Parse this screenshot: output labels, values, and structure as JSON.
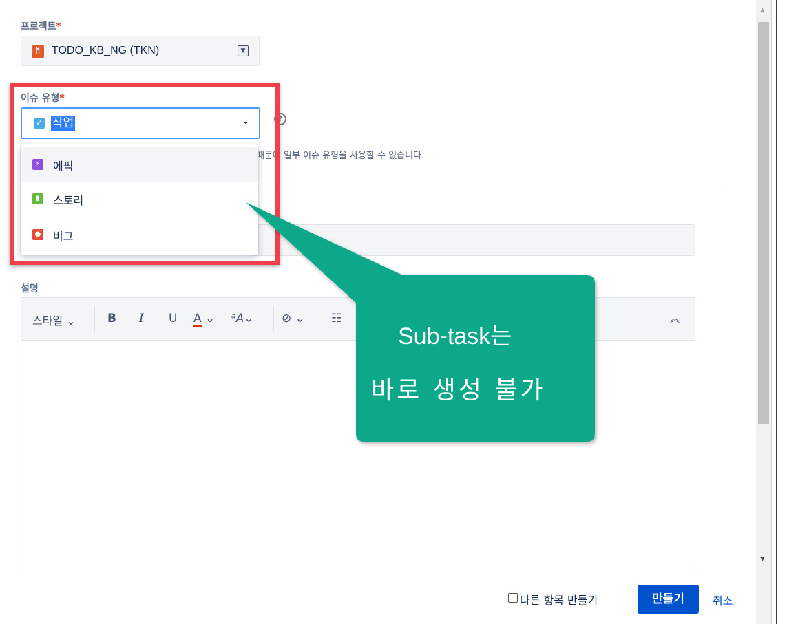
{
  "project": {
    "label": "프로젝트",
    "required_mark": "*",
    "value": "TODO_KB_NG (TKN)",
    "icon": "project-avatar-icon"
  },
  "issue_type": {
    "label": "이슈 유형",
    "required_mark": "*",
    "value": "작업",
    "icon": "task-check-icon",
    "help_icon": "?",
    "note": "때문에 일부 이슈 유형을 사용할 수 없습니다.",
    "options": [
      {
        "label": "에픽",
        "icon": "epic-lightning-icon",
        "color": "#904ee2"
      },
      {
        "label": "스토리",
        "icon": "story-bookmark-icon",
        "color": "#63ba3c"
      },
      {
        "label": "버그",
        "icon": "bug-dot-icon",
        "color": "#e5493a"
      }
    ]
  },
  "description": {
    "label": "설명",
    "toolbar": {
      "style": "스타일",
      "bold": "B",
      "italic": "I",
      "underline": "U",
      "text_color": "A",
      "text_size": "ᵃA",
      "link": "⊘",
      "list": "☷",
      "collapse": "︽"
    }
  },
  "callout": {
    "line1": "Sub-task는",
    "line2": "바로 생성 불가",
    "color": "#10a88a"
  },
  "footer": {
    "create_another": "다른 항목 만들기",
    "create_button": "만들기",
    "cancel": "취소"
  },
  "colors": {
    "highlight": "#f0414b",
    "primary": "#0052cc",
    "focus": "#4c9aff"
  }
}
